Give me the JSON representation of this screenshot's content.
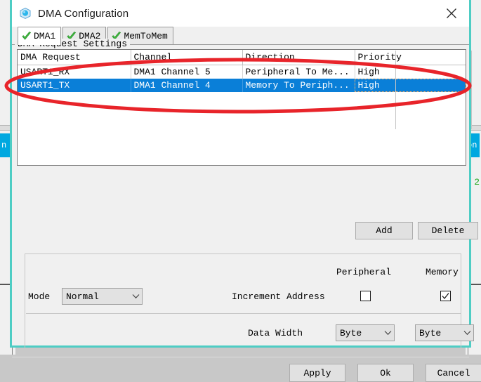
{
  "window": {
    "title": "DMA Configuration",
    "icon": "dma-cube-icon",
    "close_label": "×",
    "border_color": "#4ecdc4"
  },
  "tabs": [
    {
      "label": "DMA1",
      "icon": "green-check-icon",
      "active": true
    },
    {
      "label": "DMA2",
      "icon": "green-check-icon",
      "active": false
    },
    {
      "label": "MemToMem",
      "icon": "green-check-icon",
      "active": false
    }
  ],
  "table": {
    "columns": [
      "DMA Request",
      "Channel",
      "Direction",
      "Priority"
    ],
    "rows": [
      {
        "request": "USART1_RX",
        "channel": "DMA1 Channel 5",
        "direction": "Peripheral To Me...",
        "priority": "High",
        "selected": false
      },
      {
        "request": "USART1_TX",
        "channel": "DMA1 Channel 4",
        "direction": "Memory To Periph...",
        "priority": "High",
        "selected": true
      }
    ],
    "selection_color": "#0a7fd8"
  },
  "actions": {
    "add_label": "Add",
    "delete_label": "Delete"
  },
  "settings": {
    "legend": "DMA Request Settings",
    "peripheral_header": "Peripheral",
    "memory_header": "Memory",
    "mode_label": "Mode",
    "mode_value": "Normal",
    "increment_address_label": "Increment Address",
    "peripheral_increment_checked": "false",
    "memory_increment_checked": "true",
    "data_width_label": "Data Width",
    "peripheral_data_width": "Byte",
    "memory_data_width": "Byte"
  },
  "footer": {
    "apply_label": "Apply",
    "ok_label": "Ok",
    "cancel_label": "Cancel"
  },
  "background": {
    "left_band_text": "n",
    "right_band_text": "on",
    "right_number": "2",
    "band_color": "#00a8e0",
    "number_color": "#22aa22"
  },
  "annotation": {
    "shape": "ellipse",
    "color": "#e8242a"
  }
}
